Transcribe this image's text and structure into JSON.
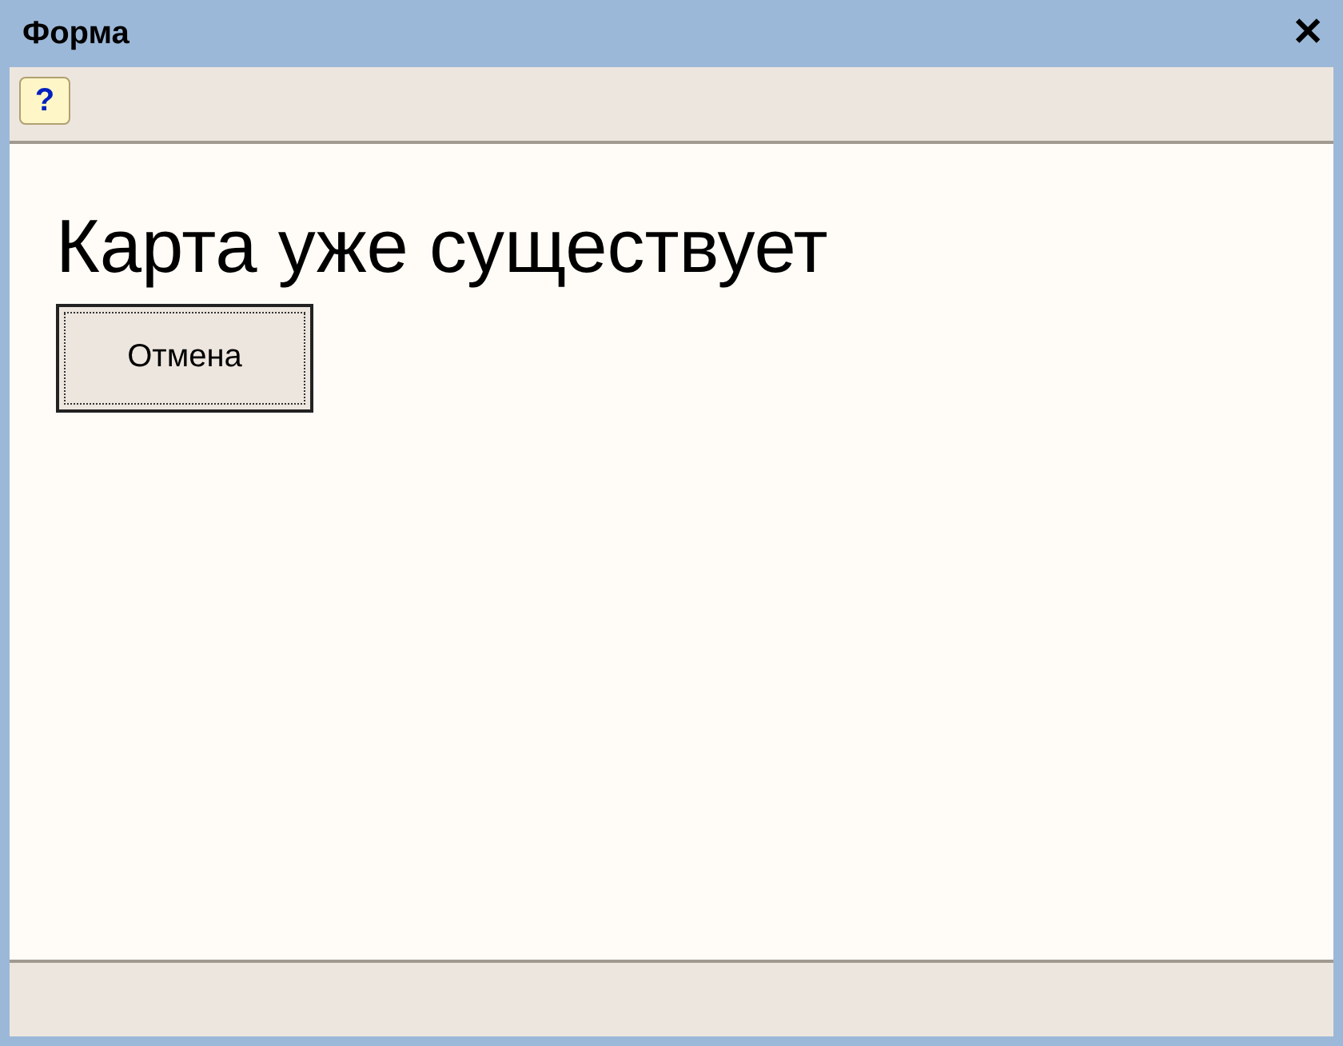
{
  "window": {
    "title": "Форма",
    "close": "✕"
  },
  "toolbar": {
    "help_button": {
      "label": "?"
    }
  },
  "heading": "Карта уже существует",
  "buttons": [
    {
      "label": "Отмена"
    }
  ]
}
